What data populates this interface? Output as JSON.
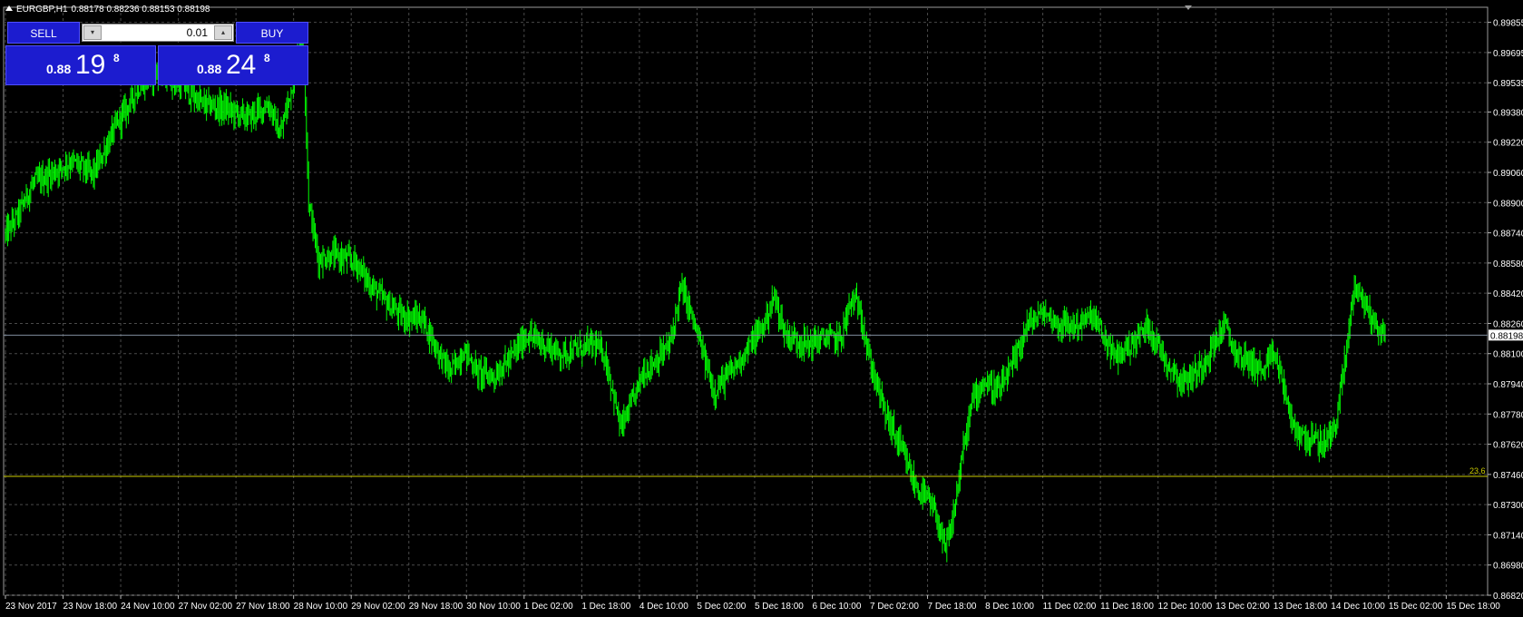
{
  "header": {
    "symbol": "EURGBP,H1",
    "ohlc": "0.88178 0.88236 0.88153 0.88198"
  },
  "trade_panel": {
    "sell_label": "SELL",
    "buy_label": "BUY",
    "lot_value": "0.01",
    "sell_price": {
      "prefix": "0.88",
      "big": "19",
      "sup": "8"
    },
    "buy_price": {
      "prefix": "0.88",
      "big": "24",
      "sup": "8"
    }
  },
  "colors": {
    "background": "#000000",
    "candle": "#00ff00",
    "grid": "#4a4a4a",
    "axis_text": "#ffffff",
    "bid_line": "#7f8c9c",
    "fib_line": "#cccc00",
    "panel": "#1c1ccf"
  },
  "chart_data": {
    "type": "candlestick",
    "title": "",
    "xlabel": "",
    "ylabel": "",
    "ylim": [
      0.8682,
      0.89935
    ],
    "y_ticks": [
      "0.89855",
      "0.89695",
      "0.89535",
      "0.89380",
      "0.89220",
      "0.89060",
      "0.88900",
      "0.88740",
      "0.88580",
      "0.88420",
      "0.88260",
      "0.88100",
      "0.87940",
      "0.87780",
      "0.87620",
      "0.87460",
      "0.87300",
      "0.87140",
      "0.86980",
      "0.86820"
    ],
    "x_ticks": [
      "23 Nov 2017",
      "23 Nov 18:00",
      "24 Nov 10:00",
      "27 Nov 02:00",
      "27 Nov 18:00",
      "28 Nov 10:00",
      "29 Nov 02:00",
      "29 Nov 18:00",
      "30 Nov 10:00",
      "1 Dec 02:00",
      "1 Dec 18:00",
      "4 Dec 10:00",
      "5 Dec 02:00",
      "5 Dec 18:00",
      "6 Dec 10:00",
      "7 Dec 02:00",
      "7 Dec 18:00",
      "8 Dec 10:00",
      "11 Dec 02:00",
      "11 Dec 18:00",
      "12 Dec 10:00",
      "13 Dec 02:00",
      "13 Dec 18:00",
      "14 Dec 10:00",
      "15 Dec 02:00",
      "15 Dec 18:00"
    ],
    "current_price": "0.88198",
    "fib_level": {
      "label": "23.6",
      "value": 0.8745
    },
    "anchors": [
      [
        0,
        0.8873
      ],
      [
        10,
        0.8882
      ],
      [
        25,
        0.89
      ],
      [
        40,
        0.8905
      ],
      [
        60,
        0.8912
      ],
      [
        80,
        0.8905
      ],
      [
        100,
        0.893
      ],
      [
        120,
        0.895
      ],
      [
        140,
        0.896
      ],
      [
        160,
        0.8952
      ],
      [
        180,
        0.8942
      ],
      [
        200,
        0.894
      ],
      [
        220,
        0.8935
      ],
      [
        240,
        0.8942
      ],
      [
        250,
        0.8925
      ],
      [
        262,
        0.8955
      ],
      [
        268,
        0.8978
      ],
      [
        272,
        0.8965
      ],
      [
        276,
        0.889
      ],
      [
        285,
        0.886
      ],
      [
        300,
        0.8862
      ],
      [
        320,
        0.8858
      ],
      [
        330,
        0.8848
      ],
      [
        345,
        0.8838
      ],
      [
        360,
        0.883
      ],
      [
        380,
        0.8828
      ],
      [
        395,
        0.881
      ],
      [
        405,
        0.88
      ],
      [
        418,
        0.8812
      ],
      [
        430,
        0.88
      ],
      [
        445,
        0.8798
      ],
      [
        460,
        0.8808
      ],
      [
        475,
        0.882
      ],
      [
        490,
        0.8815
      ],
      [
        505,
        0.881
      ],
      [
        520,
        0.8812
      ],
      [
        535,
        0.8815
      ],
      [
        545,
        0.881
      ],
      [
        553,
        0.879
      ],
      [
        560,
        0.877
      ],
      [
        568,
        0.878
      ],
      [
        580,
        0.88
      ],
      [
        595,
        0.8808
      ],
      [
        605,
        0.8815
      ],
      [
        615,
        0.8845
      ],
      [
        622,
        0.8835
      ],
      [
        635,
        0.881
      ],
      [
        645,
        0.879
      ],
      [
        660,
        0.88
      ],
      [
        675,
        0.8812
      ],
      [
        690,
        0.8825
      ],
      [
        700,
        0.884
      ],
      [
        710,
        0.882
      ],
      [
        730,
        0.8815
      ],
      [
        745,
        0.8818
      ],
      [
        760,
        0.8818
      ],
      [
        770,
        0.8838
      ],
      [
        778,
        0.8835
      ],
      [
        785,
        0.881
      ],
      [
        800,
        0.878
      ],
      [
        815,
        0.876
      ],
      [
        828,
        0.874
      ],
      [
        840,
        0.8732
      ],
      [
        848,
        0.8723
      ],
      [
        855,
        0.8705
      ],
      [
        862,
        0.872
      ],
      [
        870,
        0.8752
      ],
      [
        880,
        0.8785
      ],
      [
        890,
        0.8795
      ],
      [
        905,
        0.879
      ],
      [
        918,
        0.8805
      ],
      [
        930,
        0.8825
      ],
      [
        945,
        0.8832
      ],
      [
        960,
        0.8825
      ],
      [
        975,
        0.8825
      ],
      [
        990,
        0.883
      ],
      [
        1000,
        0.8818
      ],
      [
        1010,
        0.8808
      ],
      [
        1025,
        0.8815
      ],
      [
        1040,
        0.8825
      ],
      [
        1055,
        0.8808
      ],
      [
        1070,
        0.8795
      ],
      [
        1085,
        0.88
      ],
      [
        1100,
        0.8815
      ],
      [
        1110,
        0.8825
      ],
      [
        1120,
        0.881
      ],
      [
        1135,
        0.8805
      ],
      [
        1145,
        0.88
      ],
      [
        1155,
        0.881
      ],
      [
        1165,
        0.879
      ],
      [
        1172,
        0.877
      ],
      [
        1185,
        0.8765
      ],
      [
        1200,
        0.8762
      ],
      [
        1210,
        0.877
      ],
      [
        1220,
        0.8808
      ],
      [
        1228,
        0.8848
      ],
      [
        1236,
        0.8838
      ],
      [
        1248,
        0.8825
      ],
      [
        1256,
        0.8819
      ]
    ]
  }
}
